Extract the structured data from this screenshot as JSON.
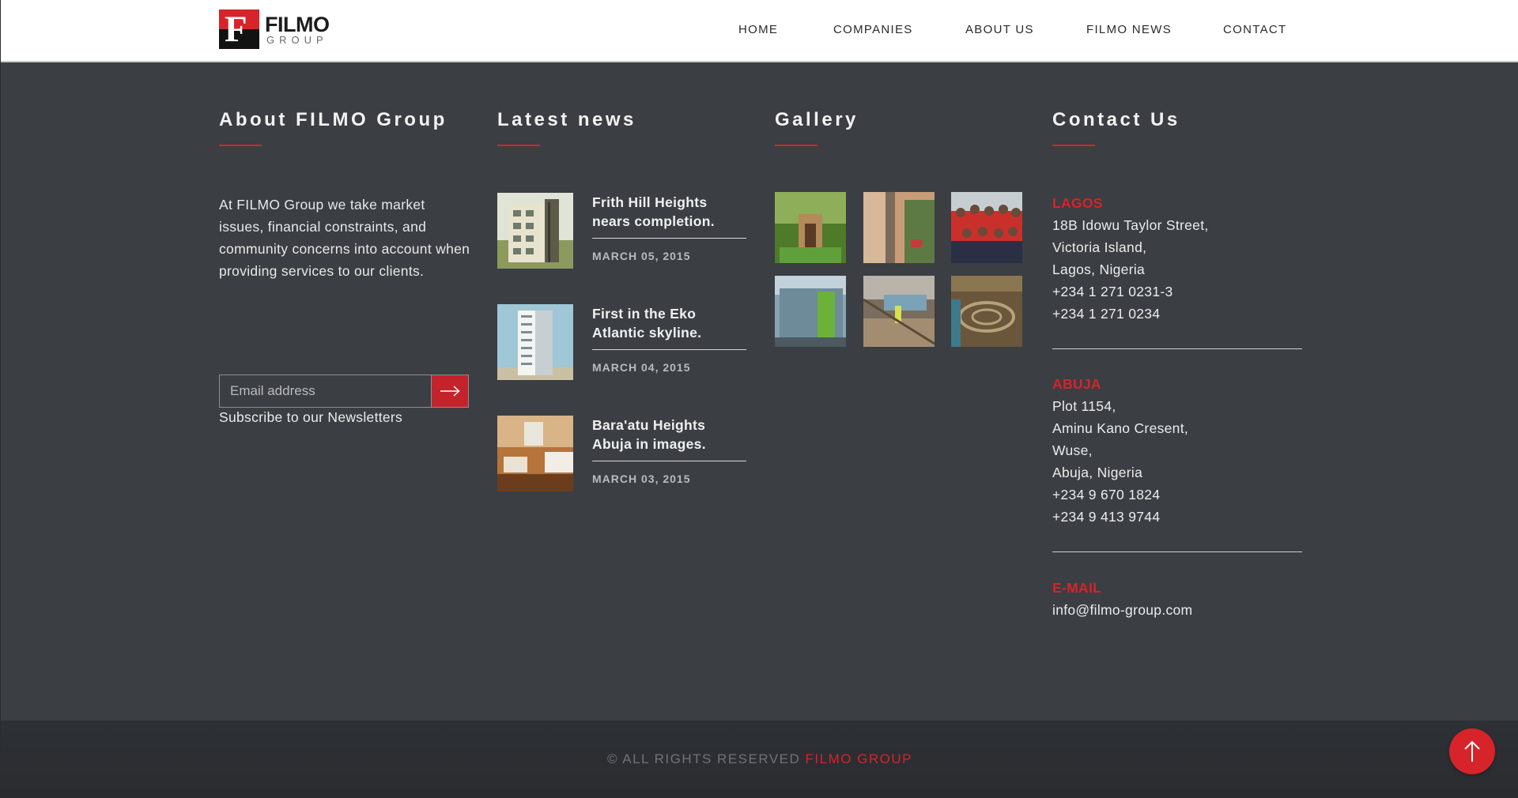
{
  "header": {
    "logo": {
      "mark": "F",
      "word": "FILMO",
      "sub": "GROUP"
    },
    "nav": [
      {
        "label": "HOME"
      },
      {
        "label": "COMPANIES"
      },
      {
        "label": "ABOUT US"
      },
      {
        "label": "FILMO NEWS"
      },
      {
        "label": "CONTACT"
      }
    ]
  },
  "about": {
    "title": "About FILMO Group",
    "text": "At FILMO Group we take market issues, financial constraints, and community concerns into account when providing services to our clients.",
    "email_placeholder": "Email address",
    "subscribe_label": "Subscribe to our Newsletters"
  },
  "news": {
    "title": "Latest news",
    "items": [
      {
        "title": "Frith Hill Heights nears completion.",
        "date": "MARCH 05, 2015"
      },
      {
        "title": "First in the Eko Atlantic skyline.",
        "date": "MARCH 04, 2015"
      },
      {
        "title": "Bara'atu Heights Abuja in images.",
        "date": "MARCH 03, 2015"
      }
    ]
  },
  "gallery": {
    "title": "Gallery"
  },
  "contact": {
    "title": "Contact Us",
    "lagos": {
      "label": "LAGOS",
      "lines": [
        "18B Idowu Taylor Street,",
        "Victoria Island,",
        "Lagos, Nigeria",
        "+234 1 271 0231-3",
        "+234 1 271 0234"
      ]
    },
    "abuja": {
      "label": "ABUJA",
      "lines": [
        "Plot 1154,",
        "Aminu Kano Cresent,",
        "Wuse,",
        "Abuja, Nigeria",
        "+234 9 670 1824",
        "+234 9 413 9744"
      ]
    },
    "email": {
      "label": "E-MAIL",
      "value": "info@filmo-group.com"
    }
  },
  "footer": {
    "copyright_prefix": "© ALL RIGHTS RESERVED",
    "brand": "FILMO GROUP"
  },
  "colors": {
    "accent": "#d7232a",
    "background": "#3b3e43",
    "footer": "#2d3034"
  }
}
